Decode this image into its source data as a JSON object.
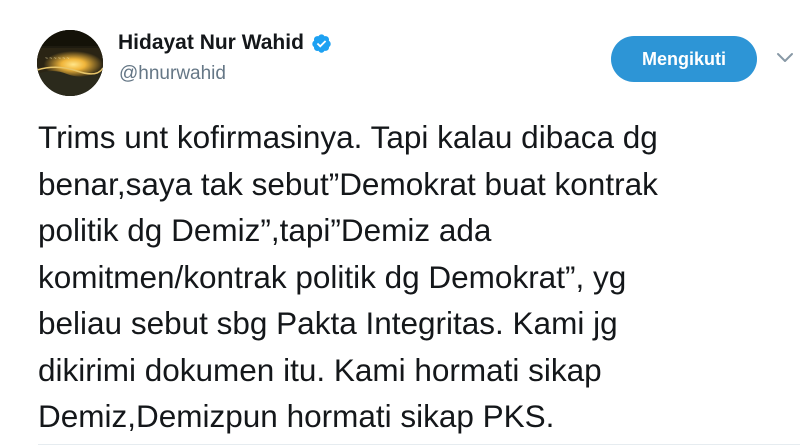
{
  "author": {
    "name": "Hidayat Nur Wahid",
    "handle": "@hnurwahid",
    "verified": true,
    "avatar_icon": "profile-photo-sunset"
  },
  "actions": {
    "follow_label": "Mengikuti",
    "more_icon": "chevron-down-icon"
  },
  "tweet": {
    "text": "Trims unt kofirmasinya. Tapi kalau dibaca dg\nbenar,saya tak sebut”Demokrat buat kontrak\npolitik dg Demiz”,tapi”Demiz ada\nkomitmen/kontrak politik dg Demokrat”, yg\nbeliau sebut sbg Pakta Integritas. Kami jg\ndikirimi dokumen itu. Kami hormati sikap\nDemiz,Demizpun hormati sikap PKS."
  },
  "colors": {
    "follow_button": "#2d95d6",
    "verified_badge": "#1da1f2",
    "text": "#14171a",
    "handle": "#657786"
  }
}
